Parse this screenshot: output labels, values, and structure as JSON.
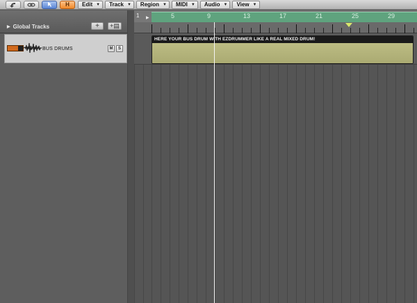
{
  "toolbar": {
    "icons": [
      "back-icon",
      "link-icon",
      "pointer-tool-icon",
      "h-icon"
    ],
    "catch_label": "H",
    "menus": [
      {
        "label": "Edit"
      },
      {
        "label": "Track"
      },
      {
        "label": "Region"
      },
      {
        "label": "MIDI"
      },
      {
        "label": "Audio"
      },
      {
        "label": "View"
      }
    ]
  },
  "global_tracks": {
    "label": "Global Tracks",
    "add_label": "+",
    "dup_label": "+▤"
  },
  "track": {
    "name": "BUS DRUMS",
    "mute_label": "M",
    "solo_label": "S",
    "color": "#d16a1d"
  },
  "ruler": {
    "start_label": "1",
    "bars": [
      "5",
      "9",
      "13",
      "17",
      "21",
      "25",
      "29"
    ]
  },
  "region": {
    "title": "HERE YOUR BUS DRUM WITH EZDRUMMER LIKE A REAL MIXED DRUM!",
    "color": "#b5b57d"
  },
  "colors": {
    "cycle": "#5fa37e",
    "playhead": "#f4f4f4"
  }
}
